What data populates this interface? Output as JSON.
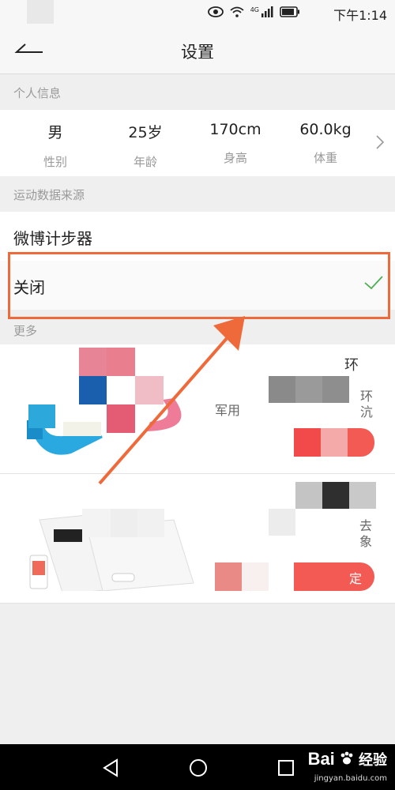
{
  "status_bar": {
    "time": "下午1:14",
    "network": "4G"
  },
  "header": {
    "title": "设置"
  },
  "personal_info": {
    "section_label": "个人信息",
    "items": [
      {
        "value": "男",
        "label": "性别"
      },
      {
        "value": "25岁",
        "label": "年龄"
      },
      {
        "value": "170cm",
        "label": "身高"
      },
      {
        "value": "60.0kg",
        "label": "体重"
      }
    ]
  },
  "data_source": {
    "section_label": "运动数据来源",
    "source_name": "微博计步器",
    "selected_option": "关闭"
  },
  "more": {
    "section_label": "更多",
    "card1": {
      "title_fragment": "环",
      "desc_fragment": "军用",
      "side_fragment_1": "环",
      "side_fragment_2": "沆"
    },
    "card2": {
      "desc_fragment_1": "去",
      "desc_fragment_2": "象",
      "button_fragment": "定"
    }
  },
  "watermark": {
    "brand": "Bai",
    "brand_suffix": "经验",
    "url": "jingyan.baidu.com"
  },
  "colors": {
    "accent": "#ef6a3a",
    "check": "#4caf50",
    "cta": "#f25a53"
  }
}
